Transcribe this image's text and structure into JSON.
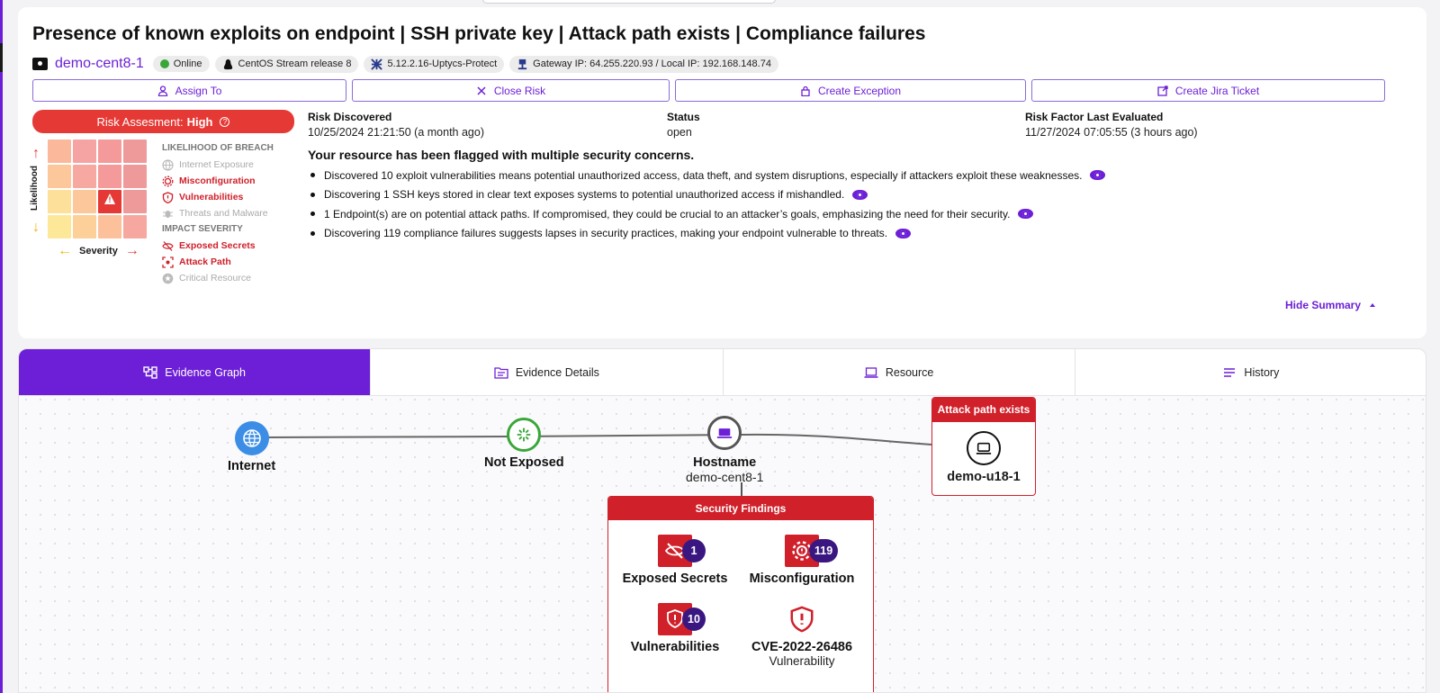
{
  "title": "Presence of known exploits on endpoint | SSH private key | Attack path exists | Compliance failures",
  "host": {
    "name": "demo-cent8-1",
    "status": "Online",
    "os": "CentOS Stream release 8",
    "agent": "5.12.2.16-Uptycs-Protect",
    "ips": "Gateway IP: 64.255.220.93 / Local IP: 192.168.148.74"
  },
  "actions": {
    "assign": "Assign To",
    "close": "Close Risk",
    "exception": "Create Exception",
    "jira": "Create Jira Ticket"
  },
  "risk": {
    "label": "Risk Assesment:",
    "level": "High",
    "ylabel": "Likelihood",
    "xlabel": "Severity"
  },
  "legend": {
    "likelihood_header": "LIKELIHOOD OF BREACH",
    "likelihood_items": [
      "Internet Exposure",
      "Misconfiguration",
      "Vulnerabilities",
      "Threats and Malware"
    ],
    "impact_header": "IMPACT SEVERITY",
    "impact_items": [
      "Exposed Secrets",
      "Attack Path",
      "Critical Resource"
    ]
  },
  "info": {
    "discovered_label": "Risk Discovered",
    "discovered_value": "10/25/2024 21:21:50 (a month ago)",
    "status_label": "Status",
    "status_value": "open",
    "evaluated_label": "Risk Factor Last Evaluated",
    "evaluated_value": "11/27/2024 07:05:55 (3 hours ago)"
  },
  "summary": {
    "heading": "Your resource has been flagged with multiple security concerns.",
    "bullets": [
      "Discovered 10 exploit vulnerabilities means potential unauthorized access, data theft, and system disruptions, especially if attackers exploit these weaknesses.",
      "Discovering 1 SSH keys stored in clear text exposes systems to potential unauthorized access if mishandled.",
      "1 Endpoint(s) are on potential attack paths. If compromised, they could be crucial to an attacker’s goals, emphasizing the need for their security.",
      "Discovering 119 compliance failures suggests lapses in security practices, making your endpoint vulnerable to threats."
    ],
    "hide": "Hide Summary"
  },
  "tabs": [
    "Evidence Graph",
    "Evidence Details",
    "Resource",
    "History"
  ],
  "graph": {
    "internet": "Internet",
    "not_exposed": "Not Exposed",
    "hostname_label": "Hostname",
    "hostname_value": "demo-cent8-1",
    "attack_header": "Attack path exists",
    "attack_node": "demo-u18-1",
    "findings_header": "Security Findings",
    "findings": [
      {
        "label": "Exposed Secrets",
        "count": "1"
      },
      {
        "label": "Misconfiguration",
        "count": "119"
      },
      {
        "label": "Vulnerabilities",
        "count": "10"
      },
      {
        "label": "CVE-2022-26486",
        "sub": "Vulnerability"
      }
    ]
  },
  "colors": {
    "accent": "#6c1fd6",
    "danger": "#d0202a",
    "badge": "#3a1780"
  }
}
